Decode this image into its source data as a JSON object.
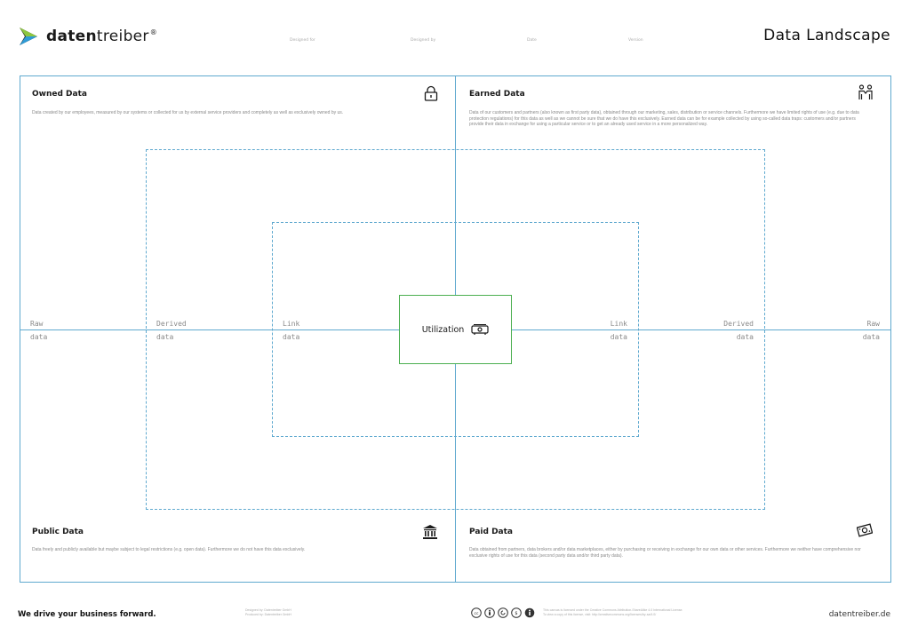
{
  "brand": {
    "name_bold": "daten",
    "name_light": "treiber",
    "registered": "®",
    "colors": {
      "green": "#8dc63f",
      "blue": "#2e9bd6",
      "dark": "#1a1a1a"
    }
  },
  "header": {
    "designed_for": "Designed for",
    "designed_by": "Designed by",
    "date": "Date",
    "version": "Version",
    "title": "Data Landscape"
  },
  "quadrants": {
    "owned": {
      "title": "Owned Data",
      "description": "Data created by our employees, measured by our systems or collected for us by external service providers and completely as well as exclusively owned by us.",
      "icon": "lock-icon"
    },
    "earned": {
      "title": "Earned Data",
      "description": "Data of our customers and partners (also known as first party data), obtained through our marketing, sales, distribution or service channels. Furthermore we have limited rights of use (e.g. due to data protection regulations) for this data as well as we cannot be sure that we do have this exclusively. Earned data can be for example collected by using so-called data traps: customers and/or partners provide their data in exchange for using a particular service or to get an already used service in a more personalized way.",
      "icon": "handshake-people-icon"
    },
    "public": {
      "title": "Public Data",
      "description": "Data freely and publicly available but maybe subject to legal restrictions (e.g. open data). Furthermore we do not have this data exclusively.",
      "icon": "bank-icon"
    },
    "paid": {
      "title": "Paid Data",
      "description": "Data obtained from partners, data brokers and/or data marketplaces, either by purchasing or receiving in exchange for our own data or other services. Furthermore we neither have comprehensive nor exclusive rights of use for this data (second party data and/or third party data).",
      "icon": "money-icon"
    }
  },
  "axis": {
    "raw_top": "Raw",
    "raw_bottom": "data",
    "derived_top": "Derived",
    "derived_bottom": "data",
    "link_top": "Link",
    "link_bottom": "data"
  },
  "center": {
    "label": "Utilization",
    "icon": "projector-icon"
  },
  "footer": {
    "tagline": "We drive your business forward.",
    "credit_line1": "Designed by: Datentreiber GmbH",
    "credit_line2": "Produced by: Datentreiber GmbH",
    "license_line1": "This canvas is licensed under the Creative Commons Attribution-ShareAlike 4.0 International License.",
    "license_line2": "To view a copy of this license, visit: http://creativecommons.org/licenses/by-sa/4.0/",
    "website": "datentreiber.de",
    "cc_icons": [
      "cc-icon",
      "by-icon",
      "sa-icon",
      "nc-icon",
      "person-icon"
    ]
  }
}
